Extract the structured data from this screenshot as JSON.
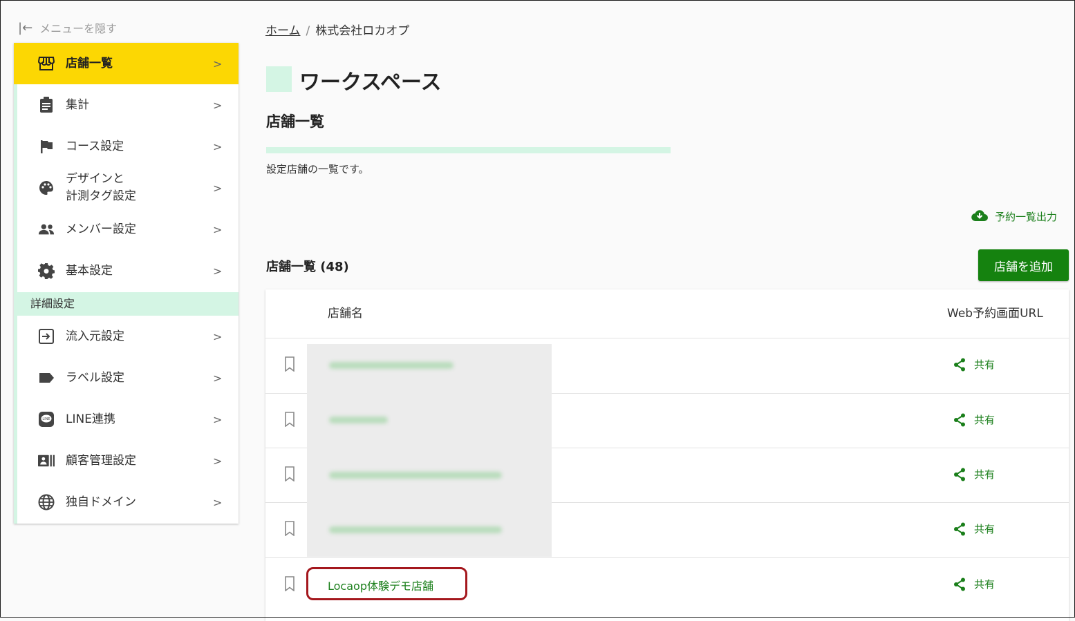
{
  "sidebar": {
    "hide_menu": "メニューを隠す",
    "items": [
      {
        "label": "店舗一覧",
        "icon": "store-icon"
      },
      {
        "label": "集計",
        "icon": "clipboard-icon"
      },
      {
        "label": "コース設定",
        "icon": "flag-icon"
      },
      {
        "label": "デザインと",
        "label2": "計測タグ設定",
        "icon": "palette-icon"
      },
      {
        "label": "メンバー設定",
        "icon": "people-icon"
      },
      {
        "label": "基本設定",
        "icon": "gear-icon"
      },
      {
        "label": "流入元設定",
        "icon": "login-icon"
      },
      {
        "label": "ラベル設定",
        "icon": "label-icon"
      },
      {
        "label": "LINE連携",
        "icon": "line-icon"
      },
      {
        "label": "顧客管理設定",
        "icon": "contact-card-icon"
      },
      {
        "label": "独自ドメイン",
        "icon": "globe-icon"
      }
    ],
    "section_label": "詳細設定",
    "chevron": ">"
  },
  "breadcrumb": {
    "home": "ホーム",
    "separator": "/",
    "current": "株式会社ロカオプ"
  },
  "workspace_title": "ワークスペース",
  "page_title": "店舗一覧",
  "description": "設定店舗の一覧です。",
  "export_label": "予約一覧出力",
  "list_title": "店舗一覧 (48)",
  "add_button": "店舗を追加",
  "table": {
    "col_name": "店舗名",
    "col_url": "Web予約画面URL",
    "share_label": "共有",
    "visible_store": "Locaop体験デモ店舗"
  },
  "colors": {
    "accent_yellow": "#fcd703",
    "mint": "#d4f5e4",
    "green": "#15820f",
    "highlight_red": "#a4171d"
  }
}
